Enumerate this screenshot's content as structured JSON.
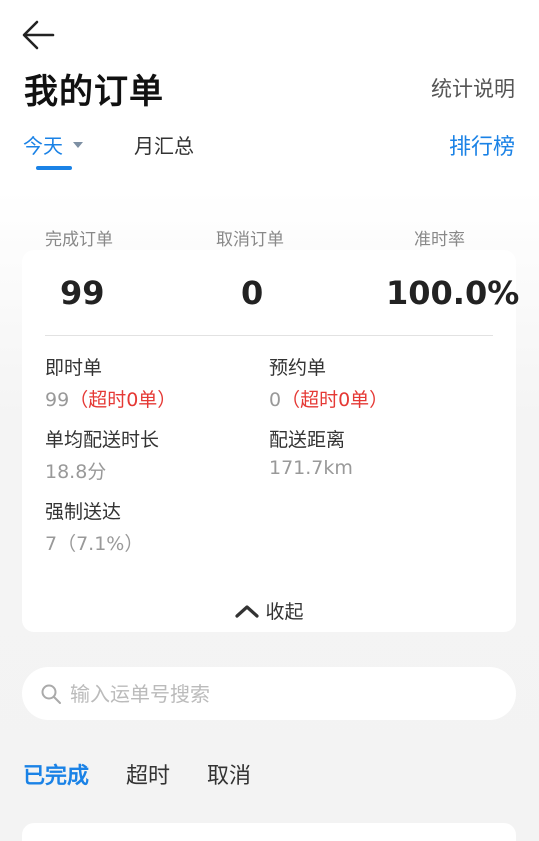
{
  "header": {
    "title": "我的订单",
    "stats_explanation": "统计说明"
  },
  "period_tabs": {
    "today": "今天",
    "month_summary": "月汇总",
    "ranking": "排行榜"
  },
  "summary": {
    "completed_label": "完成订单",
    "completed_value": "99",
    "cancelled_label": "取消订单",
    "cancelled_value": "0",
    "ontime_label": "准时率",
    "ontime_value": "100.0%"
  },
  "details": {
    "instant_label": "即时单",
    "instant_value": "99",
    "instant_overtime": "（超时0单）",
    "reserved_label": "预约单",
    "reserved_value": "0",
    "reserved_overtime": "（超时0单）",
    "avg_time_label": "单均配送时长",
    "avg_time_value": "18.8分",
    "distance_label": "配送距离",
    "distance_value": "171.7km",
    "forced_label": "强制送达",
    "forced_value": "7（7.1%）"
  },
  "collapse_label": "收起",
  "search": {
    "placeholder": "输入运单号搜索"
  },
  "status_tabs": {
    "completed": "已完成",
    "overtime": "超时",
    "cancelled": "取消"
  },
  "colors": {
    "accent": "#1a82e6",
    "alert": "#e53935"
  }
}
